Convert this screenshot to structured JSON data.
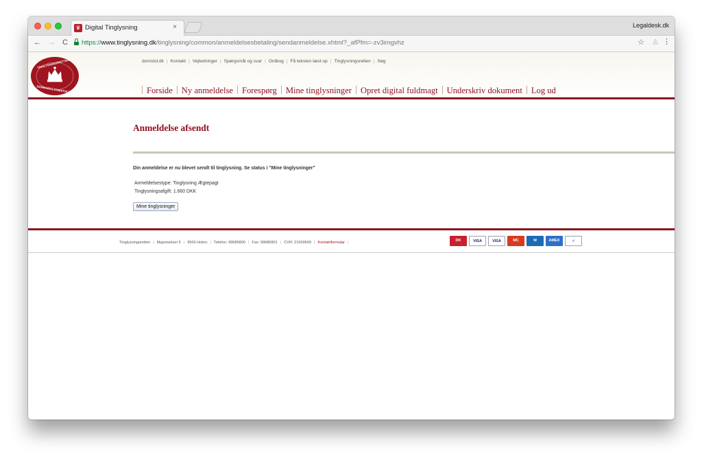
{
  "browser": {
    "tab_title": "Digital Tinglysning",
    "tab_close": "×",
    "profile_name": "Legaldesk.dk",
    "url_scheme": "https://",
    "url_host": "www.tinglysning.dk",
    "url_path": "/tinglysning/common/anmeldelsesbetaling/sendanmeldelse.xhtml?_afPfm=-zv3imgvhz",
    "nav_back": "←",
    "nav_forward": "→",
    "nav_reload": "C",
    "star": "☆",
    "menu": "⋮"
  },
  "logo": {
    "arc_text": "TINGLYSNINGSRETTEN · DANMARKS DOMSTOLE",
    "color": "#a0141f"
  },
  "top_nav": [
    "domstol.dk",
    "Kontakt",
    "Vejledninger",
    "Spørgsmål og svar",
    "Ordbog",
    "Få teksten læst op",
    "Tinglysningsretten",
    "Søg"
  ],
  "main_nav": [
    "Forside",
    "Ny anmeldelse",
    "Forespørg",
    "Mine tinglysninger",
    "Opret digital fuldmagt",
    "Underskriv dokument",
    "Log ud"
  ],
  "main": {
    "heading": "Anmeldelse afsendt",
    "message": "Din anmeldelse er nu blevet sendt til tinglysning. Se status i \"Mine tinglysninger\"",
    "type_label": "Anmeldelsestype:",
    "type_value": "Tinglysning Ægtepagt",
    "fee_label": "Tinglysningsafgift:",
    "fee_value": "1.660 DKK",
    "button_label": "Mine tinglysninger"
  },
  "footer": {
    "items": [
      "Tinglysningsretten",
      "Majsmarken 5",
      "9500 Hobro",
      "Telefon: 99685800",
      "Fax: 99685801",
      "CVR: 21659509"
    ],
    "contact_link": "Kontaktformular",
    "cards": [
      {
        "name": "dankort-icon",
        "label": "DK",
        "bg": "#c8202e",
        "fg": "#ffffff"
      },
      {
        "name": "visa-icon",
        "label": "VISA",
        "bg": "#ffffff",
        "fg": "#1a1f71"
      },
      {
        "name": "visa-electron-icon",
        "label": "VISA",
        "bg": "#ffffff",
        "fg": "#1a1f71"
      },
      {
        "name": "mastercard-icon",
        "label": "MC",
        "bg": "#d73a1f",
        "fg": "#ffffff"
      },
      {
        "name": "maestro-icon",
        "label": "M",
        "bg": "#1c6ab5",
        "fg": "#ffffff"
      },
      {
        "name": "amex-icon",
        "label": "AMEX",
        "bg": "#2d70c8",
        "fg": "#ffffff"
      },
      {
        "name": "verified-icon",
        "label": "✓",
        "bg": "#ffffff",
        "fg": "#1c6ab5"
      }
    ]
  },
  "colors": {
    "brand_red": "#8b1420",
    "nav_text": "#8b0f1d",
    "separator_line": "#cbc7b5"
  }
}
